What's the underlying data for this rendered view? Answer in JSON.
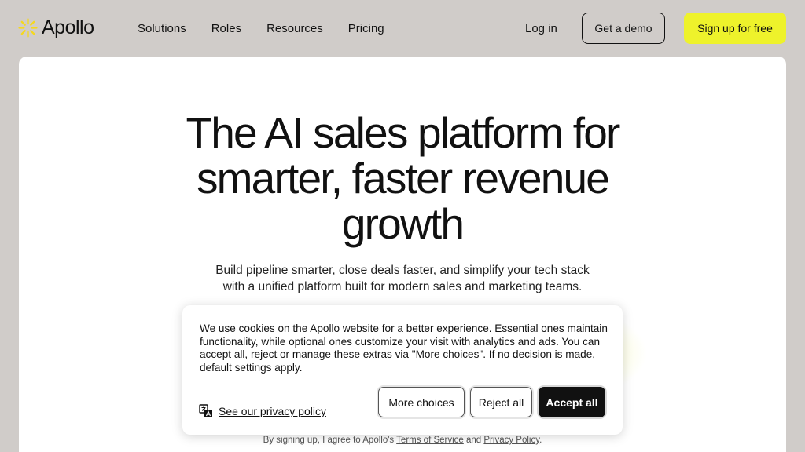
{
  "brand": {
    "name": "Apollo",
    "accent_color": "#f5d81e"
  },
  "nav": {
    "links": [
      "Solutions",
      "Roles",
      "Resources",
      "Pricing"
    ],
    "login": "Log in",
    "demo": "Get a demo",
    "signup": "Sign up for free",
    "signup_color": "#eef22b"
  },
  "hero": {
    "title_lines": [
      "The AI sales platform for",
      "smarter, faster revenue",
      "growth"
    ],
    "subtitle_lines": [
      "Build pipeline smarter, close deals faster, and simplify your tech stack",
      "with a unified platform built for modern sales and marketing teams."
    ],
    "legal_prefix": "By signing up, I agree to Apollo's ",
    "legal_terms": "Terms of Service",
    "legal_and": " and ",
    "legal_privacy": "Privacy Policy",
    "legal_suffix": "."
  },
  "cookie_banner": {
    "message": "We use cookies on the Apollo website for a better experience. Essential ones maintain functionality, while optional ones customize your visit with analytics and ads. You can accept all, reject or manage these extras via \"More choices\". If no decision is made, default settings apply.",
    "privacy_icon": "translate-icon",
    "privacy_link": "See our privacy policy",
    "more_choices": "More choices",
    "reject_all": "Reject all",
    "accept_all": "Accept all"
  }
}
